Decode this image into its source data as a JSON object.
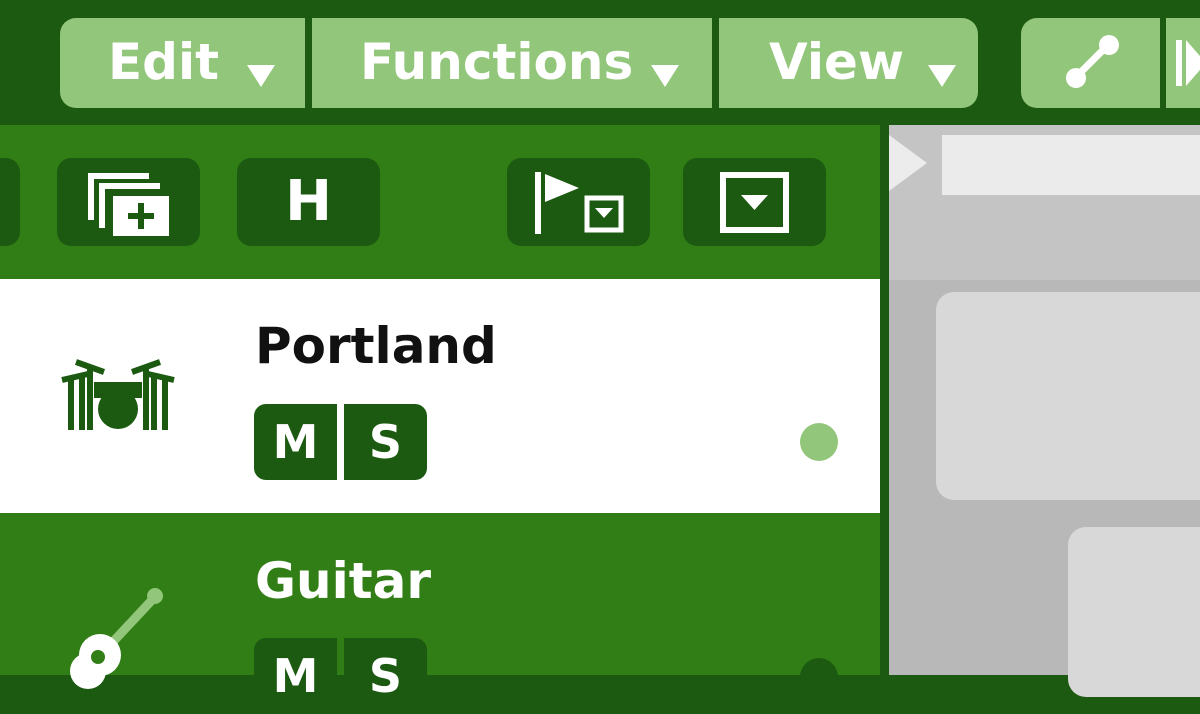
{
  "menu": {
    "edit": "Edit",
    "functions": "Functions",
    "view": "View"
  },
  "toolbar": {
    "h_label": "H",
    "icons": [
      "new-track-icon",
      "hide-track-icon",
      "marker-flag-icon",
      "dropdown-box-icon",
      "automation-line-icon",
      "play-icon"
    ]
  },
  "tracks": [
    {
      "name": "Portland",
      "mute": "M",
      "solo": "S",
      "icon": "drum-kit-icon",
      "selected": true
    },
    {
      "name": "Guitar",
      "mute": "M",
      "solo": "S",
      "icon": "acoustic-guitar-icon",
      "selected": false
    }
  ],
  "colors": {
    "dark_green": "#1b5a10",
    "mid_green": "#327e16",
    "light_green": "#92c67a",
    "arrange_gray": "#b8b8b8"
  }
}
